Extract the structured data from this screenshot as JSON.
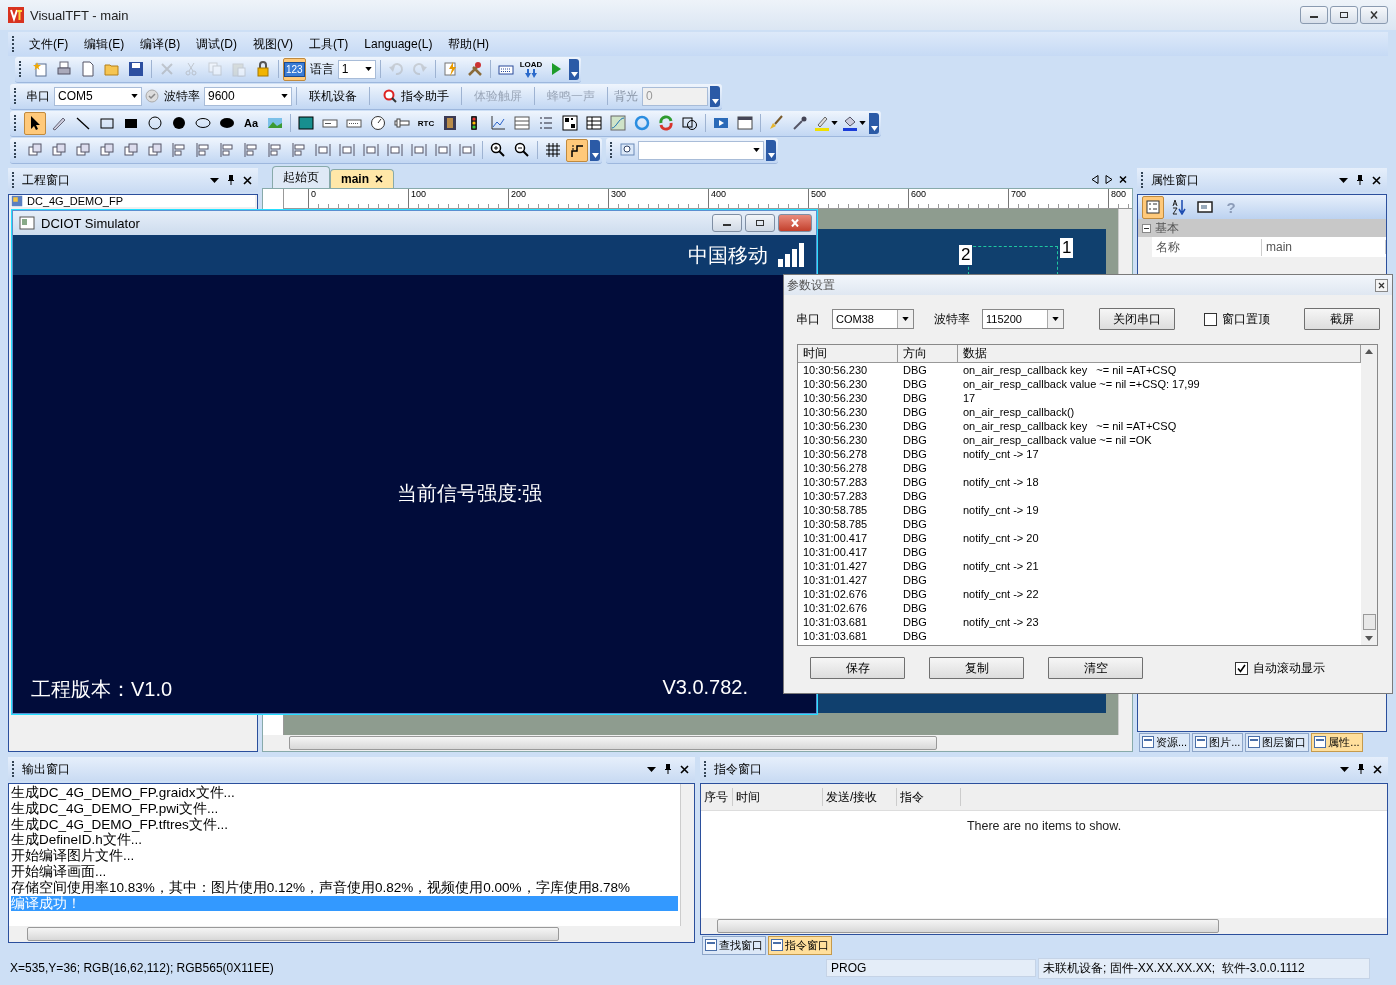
{
  "window": {
    "title": "VisualTFT - main"
  },
  "menu": [
    {
      "label": "文件(F)"
    },
    {
      "label": "编辑(E)"
    },
    {
      "label": "编译(B)"
    },
    {
      "label": "调试(D)"
    },
    {
      "label": "视图(V)"
    },
    {
      "label": "工具(T)"
    },
    {
      "label": "Language(L)"
    },
    {
      "label": "帮助(H)"
    }
  ],
  "standard_toolbar": {
    "left_buttons": [
      {
        "kind": "project",
        "disabled": false
      },
      {
        "kind": "print",
        "disabled": false
      },
      {
        "kind": "new",
        "disabled": false
      },
      {
        "kind": "open",
        "disabled": false
      },
      {
        "kind": "save",
        "disabled": false
      },
      {
        "kind": "delete",
        "disabled": true
      },
      {
        "kind": "cut",
        "disabled": true
      },
      {
        "kind": "copy",
        "disabled": true
      },
      {
        "kind": "paste",
        "disabled": true
      },
      {
        "kind": "lock",
        "disabled": false
      }
    ],
    "number_toggle": {
      "label": "123",
      "selected": true
    },
    "language_label": "语言",
    "language_value": "1",
    "right_buttons": [
      {
        "kind": "undo",
        "disabled": true
      },
      {
        "kind": "redo",
        "disabled": true
      },
      {
        "kind": "compile",
        "disabled": false
      },
      {
        "kind": "tools",
        "disabled": false
      },
      {
        "kind": "keyboard",
        "disabled": false
      },
      {
        "kind": "load",
        "label": "LOAD",
        "disabled": false
      },
      {
        "kind": "play",
        "disabled": false
      }
    ]
  },
  "serial_toolbar": {
    "port_label": "串口",
    "port_value": "COM5",
    "baud_label": "波特率",
    "baud_value": "9600",
    "buttons": [
      {
        "label": "联机设备",
        "disabled": false
      },
      {
        "label": "指令助手",
        "disabled": false
      },
      {
        "label": "体验触屏",
        "disabled": true
      },
      {
        "label": "蜂鸣一声",
        "disabled": true
      }
    ],
    "backlight_label": "背光",
    "backlight_value": "0"
  },
  "drawing_toolbar": {
    "tools": [
      {
        "kind": "pointer",
        "selected": true
      },
      {
        "kind": "pen",
        "selected": false
      },
      {
        "kind": "line",
        "selected": false
      },
      {
        "kind": "rect",
        "selected": false
      },
      {
        "kind": "filledrect",
        "selected": false
      },
      {
        "kind": "circle",
        "selected": false
      },
      {
        "kind": "disc",
        "selected": false
      },
      {
        "kind": "ellipse",
        "selected": false
      },
      {
        "kind": "filledellipse",
        "selected": false
      },
      {
        "kind": "text",
        "label": "Aa",
        "selected": false
      },
      {
        "kind": "image",
        "selected": false
      },
      {
        "kind": "screen",
        "selected": false
      },
      {
        "kind": "textbox",
        "selected": false
      },
      {
        "kind": "numbox",
        "selected": false
      },
      {
        "kind": "gauge",
        "selected": false
      },
      {
        "kind": "slider",
        "selected": false
      },
      {
        "kind": "rtc",
        "label": "RTC",
        "selected": false
      },
      {
        "kind": "film",
        "selected": false
      },
      {
        "kind": "traffic",
        "selected": false
      },
      {
        "kind": "chart",
        "selected": false
      },
      {
        "kind": "listbox",
        "selected": false
      },
      {
        "kind": "bullets",
        "selected": false
      },
      {
        "kind": "qr",
        "selected": false
      },
      {
        "kind": "table",
        "selected": false
      },
      {
        "kind": "curve",
        "selected": false
      },
      {
        "kind": "ring",
        "selected": false
      },
      {
        "kind": "refresh",
        "selected": false
      },
      {
        "kind": "overlap",
        "selected": false
      },
      {
        "kind": "video",
        "selected": false
      },
      {
        "kind": "window",
        "selected": false
      },
      {
        "kind": "brush",
        "selected": false
      },
      {
        "kind": "dropper",
        "selected": false
      },
      {
        "kind": "highlight",
        "selected": false
      },
      {
        "kind": "fill",
        "selected": false
      }
    ]
  },
  "layout_toolbar": {
    "tools": [
      {
        "kind": "layer",
        "selected": false
      },
      {
        "kind": "layer",
        "selected": false
      },
      {
        "kind": "layer",
        "selected": false
      },
      {
        "kind": "layer",
        "selected": false
      },
      {
        "kind": "layer",
        "selected": false
      },
      {
        "kind": "layer",
        "selected": false
      },
      {
        "kind": "align",
        "selected": false
      },
      {
        "kind": "align",
        "selected": false
      },
      {
        "kind": "align",
        "selected": false
      },
      {
        "kind": "align",
        "selected": false
      },
      {
        "kind": "align",
        "selected": false
      },
      {
        "kind": "align",
        "selected": false
      },
      {
        "kind": "spacing",
        "selected": false
      },
      {
        "kind": "spacing",
        "selected": false
      },
      {
        "kind": "spacing",
        "selected": false
      },
      {
        "kind": "spacing",
        "selected": false
      },
      {
        "kind": "spacing",
        "selected": false
      },
      {
        "kind": "spacing",
        "selected": false
      },
      {
        "kind": "spacing",
        "selected": false
      },
      {
        "kind": "zoomin",
        "selected": false
      },
      {
        "kind": "zoomout",
        "selected": false
      },
      {
        "kind": "grid",
        "selected": false
      },
      {
        "kind": "snap",
        "selected": true
      }
    ]
  },
  "project_panel": {
    "title": "工程窗口",
    "tree": [
      {
        "label": "DC_4G_DEMO_FP"
      }
    ]
  },
  "editor": {
    "tabs": [
      {
        "label": "起始页",
        "selected": false
      },
      {
        "label": "main",
        "selected": true
      }
    ],
    "ruler_labels": [
      "0",
      "100",
      "200",
      "300",
      "400",
      "500",
      "600",
      "700",
      "800"
    ],
    "markers": [
      "2",
      "1"
    ]
  },
  "property_panel": {
    "title": "属性窗口",
    "tools": [
      {
        "kind": "categorized",
        "selected": true
      },
      {
        "kind": "alphabetical",
        "selected": false
      },
      {
        "kind": "pages",
        "selected": false
      },
      {
        "kind": "help",
        "label": "?",
        "selected": false
      }
    ],
    "group": "基本",
    "rows": [
      {
        "name": "名称",
        "value": "main"
      }
    ],
    "tabs": [
      {
        "label": "资源...",
        "selected": false
      },
      {
        "label": "图片...",
        "selected": false
      },
      {
        "label": "图层窗口",
        "selected": false
      },
      {
        "label": "属性...",
        "selected": true
      }
    ]
  },
  "output_panel": {
    "title": "输出窗口",
    "lines": [
      {
        "text": "生成DC_4G_DEMO_FP.graidx文件...",
        "selected": false
      },
      {
        "text": "生成DC_4G_DEMO_FP.pwi文件...",
        "selected": false
      },
      {
        "text": "生成DC_4G_DEMO_FP.tftres文件...",
        "selected": false
      },
      {
        "text": "生成DefineID.h文件...",
        "selected": false
      },
      {
        "text": "开始编译图片文件...",
        "selected": false
      },
      {
        "text": "开始编译画面...",
        "selected": false
      },
      {
        "text": "存储空间使用率10.83%，其中：图片使用0.12%，声音使用0.82%，视频使用0.00%，字库使用8.78%",
        "selected": false
      },
      {
        "text": "编译成功！",
        "selected": true
      }
    ]
  },
  "command_panel": {
    "title": "指令窗口",
    "columns": [
      "序号",
      "时间",
      "发送/接收",
      "指令"
    ],
    "empty_message": "There are no items to show.",
    "tabs": [
      {
        "label": "查找窗口",
        "selected": false
      },
      {
        "label": "指令窗口",
        "selected": true
      }
    ]
  },
  "status_bar": {
    "position": "X=535,Y=36; RGB(16,62,112); RGB565(0X11EE)",
    "mode": "PROG",
    "device": "未联机设备; 固件-XX.XX.XX.XX;  软件-3.0.0.1112"
  },
  "simulator": {
    "title": "DCIOT Simulator",
    "carrier": "中国移动",
    "message": "当前信号强度:强",
    "project_version": "工程版本：V1.0",
    "version": "V3.0.782."
  },
  "dialog": {
    "title": "参数设置",
    "port_label": "串口",
    "port_value": "COM38",
    "baud_label": "波特率",
    "baud_value": "115200",
    "close_port_button": "关闭串口",
    "pin_checkbox": {
      "label": "窗口置顶",
      "checked": false
    },
    "screenshot_button": "截屏",
    "columns": [
      "时间",
      "方向",
      "数据"
    ],
    "rows": [
      {
        "time": "10:30:56.230",
        "direction": "DBG",
        "data": "on_air_resp_callback key   ~= nil =AT+CSQ"
      },
      {
        "time": "10:30:56.230",
        "direction": "DBG",
        "data": "on_air_resp_callback value ~= nil =+CSQ: 17,99"
      },
      {
        "time": "10:30:56.230",
        "direction": "DBG",
        "data": "17"
      },
      {
        "time": "10:30:56.230",
        "direction": "DBG",
        "data": "on_air_resp_callback()"
      },
      {
        "time": "10:30:56.230",
        "direction": "DBG",
        "data": "on_air_resp_callback key   ~= nil =AT+CSQ"
      },
      {
        "time": "10:30:56.230",
        "direction": "DBG",
        "data": "on_air_resp_callback value ~= nil =OK"
      },
      {
        "time": "10:30:56.278",
        "direction": "DBG",
        "data": "notify_cnt -> 17"
      },
      {
        "time": "10:30:56.278",
        "direction": "DBG",
        "data": ""
      },
      {
        "time": "10:30:57.283",
        "direction": "DBG",
        "data": "notify_cnt -> 18"
      },
      {
        "time": "10:30:57.283",
        "direction": "DBG",
        "data": ""
      },
      {
        "time": "10:30:58.785",
        "direction": "DBG",
        "data": "notify_cnt -> 19"
      },
      {
        "time": "10:30:58.785",
        "direction": "DBG",
        "data": ""
      },
      {
        "time": "10:31:00.417",
        "direction": "DBG",
        "data": "notify_cnt -> 20"
      },
      {
        "time": "10:31:00.417",
        "direction": "DBG",
        "data": ""
      },
      {
        "time": "10:31:01.427",
        "direction": "DBG",
        "data": "notify_cnt -> 21"
      },
      {
        "time": "10:31:01.427",
        "direction": "DBG",
        "data": ""
      },
      {
        "time": "10:31:02.676",
        "direction": "DBG",
        "data": "notify_cnt -> 22"
      },
      {
        "time": "10:31:02.676",
        "direction": "DBG",
        "data": ""
      },
      {
        "time": "10:31:03.681",
        "direction": "DBG",
        "data": "notify_cnt -> 23"
      },
      {
        "time": "10:31:03.681",
        "direction": "DBG",
        "data": ""
      }
    ],
    "buttons": [
      "保存",
      "复制",
      "清空"
    ],
    "autoscroll_checkbox": {
      "label": "自动滚动显示",
      "checked": true
    }
  }
}
